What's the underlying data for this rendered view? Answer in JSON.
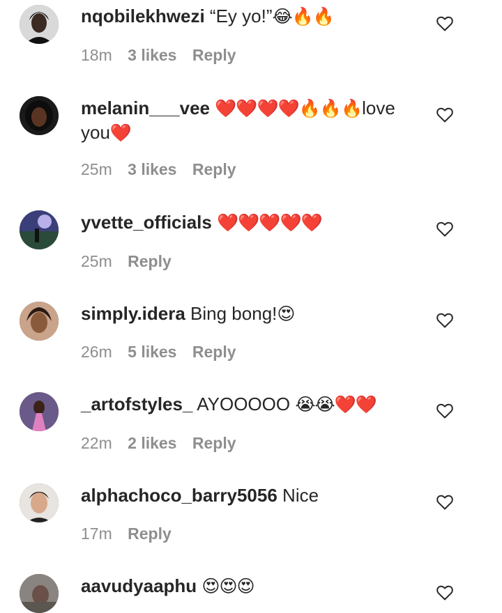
{
  "comments": [
    {
      "username": "nqobilekhwezi",
      "text": "“Ey yo!”",
      "emoji": "😂🔥🔥",
      "time": "18m",
      "likes": "3 likes",
      "reply": "Reply"
    },
    {
      "username": "melanin___vee",
      "text": "",
      "emoji": "❤️❤️❤️❤️🔥🔥🔥",
      "text_after": "love you",
      "emoji_after": "❤️",
      "time": "25m",
      "likes": "3 likes",
      "reply": "Reply"
    },
    {
      "username": "yvette_officials",
      "text": "",
      "emoji": "❤️❤️❤️❤️❤️",
      "time": "25m",
      "likes": "",
      "reply": "Reply"
    },
    {
      "username": "simply.idera",
      "text": "Bing bong!",
      "emoji": "😍",
      "time": "26m",
      "likes": "5 likes",
      "reply": "Reply"
    },
    {
      "username": "_artofstyles_",
      "text": "AYOOOOO",
      "emoji": "😭😭❤️❤️",
      "time": "22m",
      "likes": "2 likes",
      "reply": "Reply"
    },
    {
      "username": "alphachoco_barry5056",
      "text": "Nice",
      "emoji": "",
      "time": "17m",
      "likes": "",
      "reply": "Reply"
    },
    {
      "username": "aavudyaaphu",
      "text": "",
      "emoji": "😍😍😍",
      "time": "",
      "likes": "",
      "reply": ""
    }
  ],
  "icons": {
    "like": "heart-outline-icon"
  },
  "colors": {
    "text": "#262626",
    "meta": "#8e8e8e"
  }
}
